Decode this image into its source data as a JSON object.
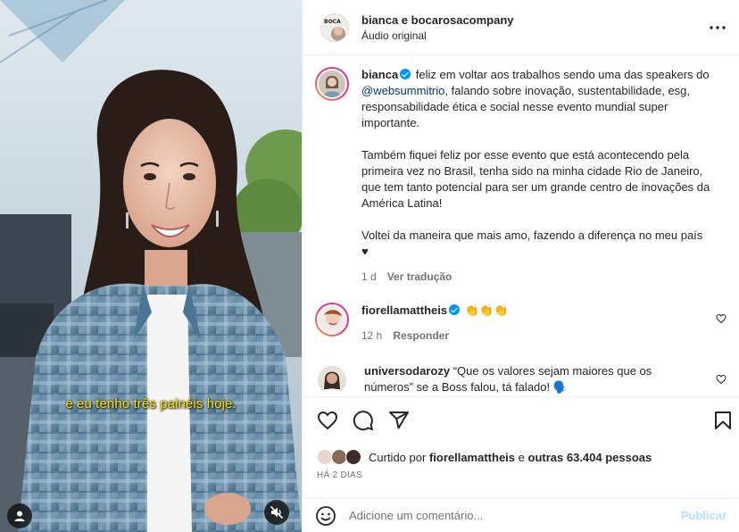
{
  "media": {
    "subtitle": "e eu tenho três painéis hoje.",
    "user_icon": "user-icon",
    "mute_icon": "muted-speaker-icon"
  },
  "header": {
    "title": "bianca e bocarosacompany",
    "subtitle": "Áudio original",
    "avatar_label": "BOCA",
    "more_icon": "more-dots-icon"
  },
  "caption": {
    "username": "bianca",
    "text_before_mention": " feliz em voltar aos trabalhos sendo uma das speakers do ",
    "mention": "@websummitrio",
    "text_after_mention": ", falando sobre inovação, sustentabilidade, esg, responsabilidade ética e social nesse evento mundial super importante.",
    "paragraph2": "Também fiquei feliz por esse evento que está acontecendo pela primeira vez no Brasil, tenha sido na minha cidade Rio de Janeiro, que tem tanto potencial para ser um grande centro de inovações da América Latina!",
    "paragraph3": "Voltei da maneira que mais amo, fazendo a diferença no meu país ♥",
    "time": "1 d",
    "translate": "Ver tradução"
  },
  "comments": [
    {
      "username": "fiorellamattheis",
      "text": "👏👏👏",
      "time": "12 h",
      "reply": "Responder"
    },
    {
      "username": "universodarozy",
      "text": "“Que os valores sejam maiores que os números” se a Boss falou, tá falado! 🗣️"
    }
  ],
  "actions": {
    "like_icon": "heart-icon",
    "comment_icon": "comment-bubble-icon",
    "share_icon": "send-icon",
    "save_icon": "bookmark-icon"
  },
  "likes": {
    "prefix": "Curtido por",
    "user": "fiorellamattheis",
    "middle": "e",
    "others": "outras 63.404 pessoas"
  },
  "date": "HÁ 2 DIAS",
  "add_comment": {
    "placeholder": "Adicione um comentário...",
    "publish": "Publicar",
    "emoji_icon": "emoji-smile-icon"
  },
  "colors": {
    "accent": "#0095f6",
    "publish_disabled": "#b2dffc",
    "subtitle": "#ffe600",
    "mention": "#00376b"
  }
}
